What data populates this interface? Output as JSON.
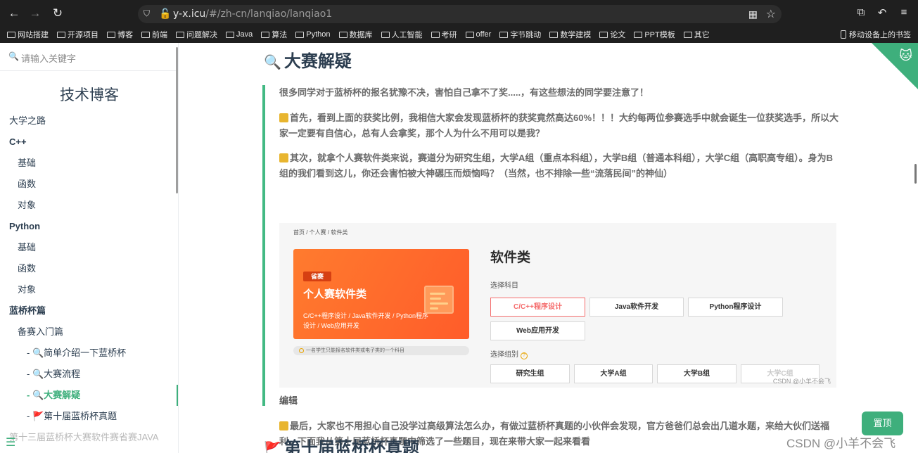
{
  "browser": {
    "url_host": "y-x.icu",
    "url_path": "/#/zh-cn/lanqiao/lanqiao1",
    "bookmarks": [
      "网站搭建",
      "开源项目",
      "博客",
      "前端",
      "问题解决",
      "Java",
      "算法",
      "Python",
      "数据库",
      "人工智能",
      "考研",
      "offer",
      "字节跳动",
      "数学建模",
      "论文",
      "PPT模板",
      "其它"
    ],
    "mobile_bookmarks": "移动设备上的书签"
  },
  "sidebar": {
    "search_placeholder": "请输入关键字",
    "site_title": "技术博客",
    "items": [
      {
        "label": "大学之路",
        "level": 0,
        "group": false
      },
      {
        "label": "C++",
        "level": 0,
        "group": true
      },
      {
        "label": "基础",
        "level": 1
      },
      {
        "label": "函数",
        "level": 1
      },
      {
        "label": "对象",
        "level": 1
      },
      {
        "label": "Python",
        "level": 0,
        "group": true
      },
      {
        "label": "基础",
        "level": 1
      },
      {
        "label": "函数",
        "level": 1
      },
      {
        "label": "对象",
        "level": 1
      },
      {
        "label": "蓝桥杯篇",
        "level": 0,
        "group": true
      },
      {
        "label": "备赛入门篇",
        "level": 1
      },
      {
        "label": "- 🔍简单介绍一下蓝桥杯",
        "level": 2
      },
      {
        "label": "- 🔍大赛流程",
        "level": 2
      },
      {
        "label": "- 🔍大赛解疑",
        "level": 2,
        "active": true
      },
      {
        "label": "- 🚩第十届蓝桥杯真题",
        "level": 2
      },
      {
        "label": "第十三届蓝桥杯大赛软件赛省赛JAVA",
        "level": 0,
        "faded": true
      }
    ]
  },
  "main": {
    "section1_title": "大赛解疑",
    "p1": "很多同学对于蓝桥杯的报名犹豫不决，害怕自己拿不了奖.....，有这些想法的同学要注意了！",
    "p2": "首先，看到上面的获奖比例，我相信大家会发现蓝桥杯的获奖竟然高达60%！！！大约每两位参赛选手中就会诞生一位获奖选手，所以大家一定要有自信心，总有人会拿奖，那个人为什么不用可以是我？",
    "p3": "其次，就拿个人赛软件类来说，赛道分为研究生组，大学A组（重点本科组），大学B组（普通本科组），大学C组（高职高专组）。身为B组的我们看到这儿，你还会害怕被大神碾压而烦恼吗？（当然，也不排除一些“流落民间”的神仙）",
    "edit_label": "编辑",
    "p4": "最后，大家也不用担心自己没学过高级算法怎么办，有做过蓝桥杯真题的小伙伴会发现，官方爸爸们总会出几道水题，来给大伙们送福利，下面我从第十届蓝桥杯真题中筛选了一些题目，现在来带大家一起来看看",
    "section2_title": "第十届蓝桥杯真题",
    "back_to_top": "置顶",
    "watermark": "CSDN @小羊不会飞"
  },
  "embedded": {
    "breadcrumb": "首页 / 个人赛 / 软件类",
    "card_tag": "省赛",
    "card_title": "个人赛软件类",
    "card_subtitle": "C/C++程序设计 / Java软件开发 / Python程序设计 / Web应用开发",
    "card_note": "一名学生只能报名软件类或电子类的一个科目",
    "right_title": "软件类",
    "subject_label": "选择科目",
    "subjects": [
      "C/C++程序设计",
      "Java软件开发",
      "Python程序设计",
      "Web应用开发"
    ],
    "group_label": "选择组别",
    "groups": [
      "研究生组",
      "大学A组",
      "大学B组",
      "大学C组"
    ],
    "watermark": "CSDN @小羊不会飞"
  },
  "icons": {
    "search": "search-icon",
    "note": "memo-icon",
    "flag": "flag-icon",
    "magnifier": "magnifier-icon",
    "corner": "github-corner-icon"
  },
  "colors": {
    "accent": "#3eaf7c",
    "tip_border": "#42b983",
    "selected": "#f56c6c"
  }
}
